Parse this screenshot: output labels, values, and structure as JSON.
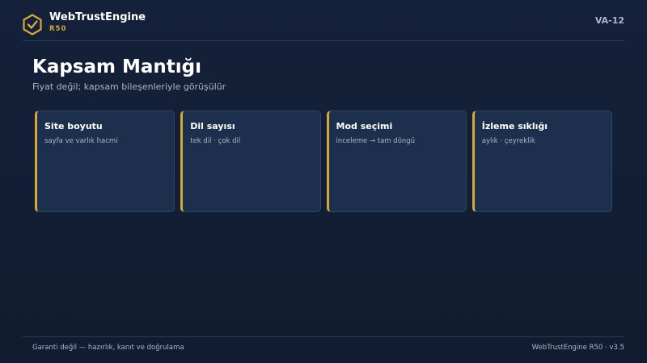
{
  "header": {
    "brand_name": "WebTrustEngine",
    "brand_sub": "R50",
    "slide_code": "VA-12",
    "logo_icon": "shield-check-icon"
  },
  "main": {
    "title": "Kapsam Mantığı",
    "subtitle": "Fiyat değil; kapsam bileşenleriyle görüşülür",
    "cards": [
      {
        "title": "Site boyutu",
        "desc": "sayfa ve varlık hacmi"
      },
      {
        "title": "Dil sayısı",
        "desc": "tek dil · çok dil"
      },
      {
        "title": "Mod seçimi",
        "desc": "inceleme → tam döngü"
      },
      {
        "title": "İzleme sıklığı",
        "desc": "aylık · çeyreklik"
      }
    ]
  },
  "footer": {
    "left": "Garanti değil — hazırlık, kanıt ve doğrulama",
    "right": "WebTrustEngine R50 · v3.5"
  },
  "colors": {
    "background": "#14213a",
    "accent": "#d4a93a",
    "card_bg": "#1c2f4c",
    "muted_text": "#aab6c8"
  }
}
